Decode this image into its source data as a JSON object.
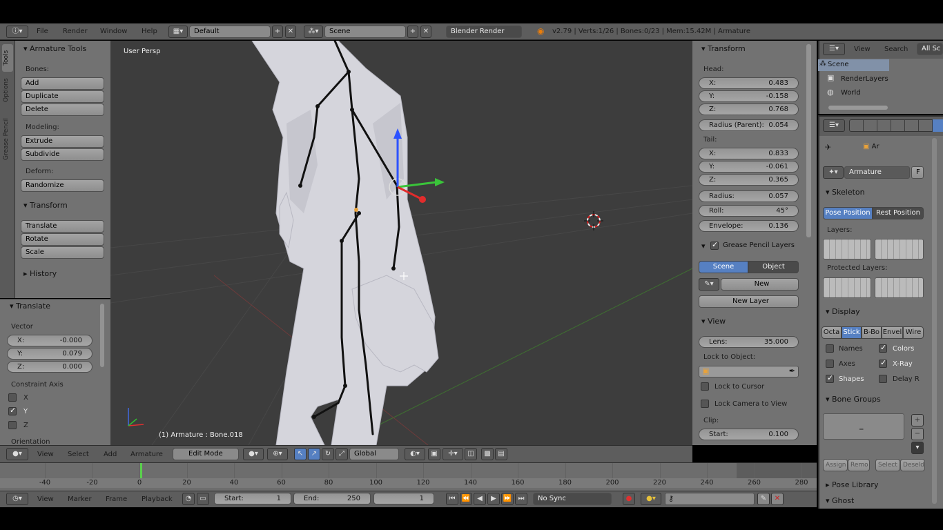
{
  "topbar": {
    "menus": [
      "File",
      "Render",
      "Window",
      "Help"
    ],
    "layout": "Default",
    "scene": "Scene",
    "engine": "Blender Render",
    "stats": "v2.79 | Verts:1/26 | Bones:0/23 | Mem:15.42M | Armature"
  },
  "left_tabs": [
    "Tools",
    "Options",
    "Grease Pencil"
  ],
  "tools": {
    "title": "Armature Tools",
    "bones_label": "Bones:",
    "bones_buttons": [
      "Add",
      "Duplicate",
      "Delete"
    ],
    "modeling_label": "Modeling:",
    "modeling_buttons": [
      "Extrude",
      "Subdivide"
    ],
    "deform_label": "Deform:",
    "deform_buttons": [
      "Randomize"
    ],
    "transform_title": "Transform",
    "transform_buttons": [
      "Translate",
      "Rotate",
      "Scale"
    ],
    "history_title": "History"
  },
  "operator": {
    "title": "Translate",
    "vector_label": "Vector",
    "x": {
      "label": "X:",
      "value": "-0.000"
    },
    "y": {
      "label": "Y:",
      "value": "0.079"
    },
    "z": {
      "label": "Z:",
      "value": "0.000"
    },
    "constraint_label": "Constraint Axis",
    "axes": [
      {
        "label": "X",
        "checked": false
      },
      {
        "label": "Y",
        "checked": true
      },
      {
        "label": "Z",
        "checked": false
      }
    ],
    "orientation_label": "Orientation"
  },
  "viewport": {
    "view_label": "User Persp",
    "object_label": "(1) Armature : Bone.018"
  },
  "view_header": {
    "menus": [
      "View",
      "Select",
      "Add",
      "Armature"
    ],
    "mode": "Edit Mode",
    "orientation": "Global"
  },
  "npanel": {
    "transform_title": "Transform",
    "head_label": "Head:",
    "head": [
      {
        "l": "X:",
        "v": "0.483"
      },
      {
        "l": "Y:",
        "v": "-0.158"
      },
      {
        "l": "Z:",
        "v": "0.768"
      }
    ],
    "radius_parent": {
      "l": "Radius (Parent):",
      "v": "0.054"
    },
    "tail_label": "Tail:",
    "tail": [
      {
        "l": "X:",
        "v": "0.833"
      },
      {
        "l": "Y:",
        "v": "-0.061"
      },
      {
        "l": "Z:",
        "v": "0.365"
      }
    ],
    "radius": {
      "l": "Radius:",
      "v": "0.057"
    },
    "roll": {
      "l": "Roll:",
      "v": "45°"
    },
    "envelope": {
      "l": "Envelope:",
      "v": "0.136"
    },
    "gp_title": "Grease Pencil Layers",
    "gp_scene": "Scene",
    "gp_object": "Object",
    "gp_new": "New",
    "gp_new_layer": "New Layer",
    "view_title": "View",
    "lens": {
      "l": "Lens:",
      "v": "35.000"
    },
    "lock_object_label": "Lock to Object:",
    "lock_cursor": "Lock to Cursor",
    "lock_camera": "Lock Camera to View",
    "clip_label": "Clip:",
    "clip_start": {
      "l": "Start:",
      "v": "0.100"
    }
  },
  "outliner": {
    "menus": [
      "View",
      "Search",
      "All Sc"
    ],
    "items": [
      "Scene",
      "RenderLayers",
      "World"
    ]
  },
  "properties": {
    "context": "Ar",
    "name": "Armature",
    "name_flag": "F",
    "skeleton_title": "Skeleton",
    "pose_position": "Pose Position",
    "rest_position": "Rest Position",
    "layers_label": "Layers:",
    "protected_label": "Protected Layers:",
    "display_title": "Display",
    "display_modes": [
      "Octa",
      "Stick",
      "B-Bo",
      "Envel",
      "Wire"
    ],
    "display_selected": "Stick",
    "checks": [
      {
        "label": "Names",
        "checked": false
      },
      {
        "label": "Colors",
        "checked": true
      },
      {
        "label": "Axes",
        "checked": false
      },
      {
        "label": "X-Ray",
        "checked": true
      },
      {
        "label": "Shapes",
        "checked": true
      },
      {
        "label": "Delay R",
        "checked": false
      }
    ],
    "bone_groups_title": "Bone Groups",
    "bg_buttons": [
      "Assign",
      "Remo",
      "Select",
      "Deseld"
    ],
    "pose_library_title": "Pose Library",
    "ghost_title": "Ghost"
  },
  "timeline": {
    "ticks": [
      "-40",
      "-20",
      "0",
      "20",
      "40",
      "60",
      "80",
      "100",
      "120",
      "140",
      "160",
      "180",
      "200",
      "220",
      "240",
      "260",
      "280"
    ],
    "menus": [
      "View",
      "Marker",
      "Frame",
      "Playback"
    ],
    "start": {
      "l": "Start:",
      "v": "1"
    },
    "end": {
      "l": "End:",
      "v": "250"
    },
    "current": "1",
    "sync": "No Sync"
  },
  "colors": {
    "viewport_bg": "#3d3d3d",
    "panel_bg": "#727272",
    "header_bg": "#5d5d5d",
    "selected_blue": "#5680c2",
    "frame_marker": "#5ad04c"
  }
}
